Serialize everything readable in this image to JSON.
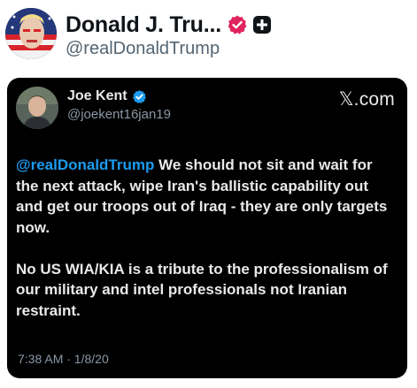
{
  "profile": {
    "display_name": "Donald J. Tru...",
    "handle": "@realDonaldTrump"
  },
  "embedded_tweet": {
    "author_name": "Joe Kent",
    "author_handle": "@joekent16jan19",
    "site_label": "𝕏.com",
    "mention": "@realDonaldTrump",
    "text_line1_rest": " We should not sit and wait for the next attack, wipe Iran's ballistic capability out and get our troops out of Iraq - they are only targets now.",
    "text_paragraph2": "No US WIA/KIA is a tribute to the professionalism of our military and intel professionals not Iranian restraint.",
    "timestamp": "7:38 AM · 1/8/20"
  },
  "colors": {
    "verified_pink": "#e0245e",
    "verified_blue": "#1d9bf0",
    "mention_blue": "#1d9bf0",
    "card_bg": "#000000"
  }
}
